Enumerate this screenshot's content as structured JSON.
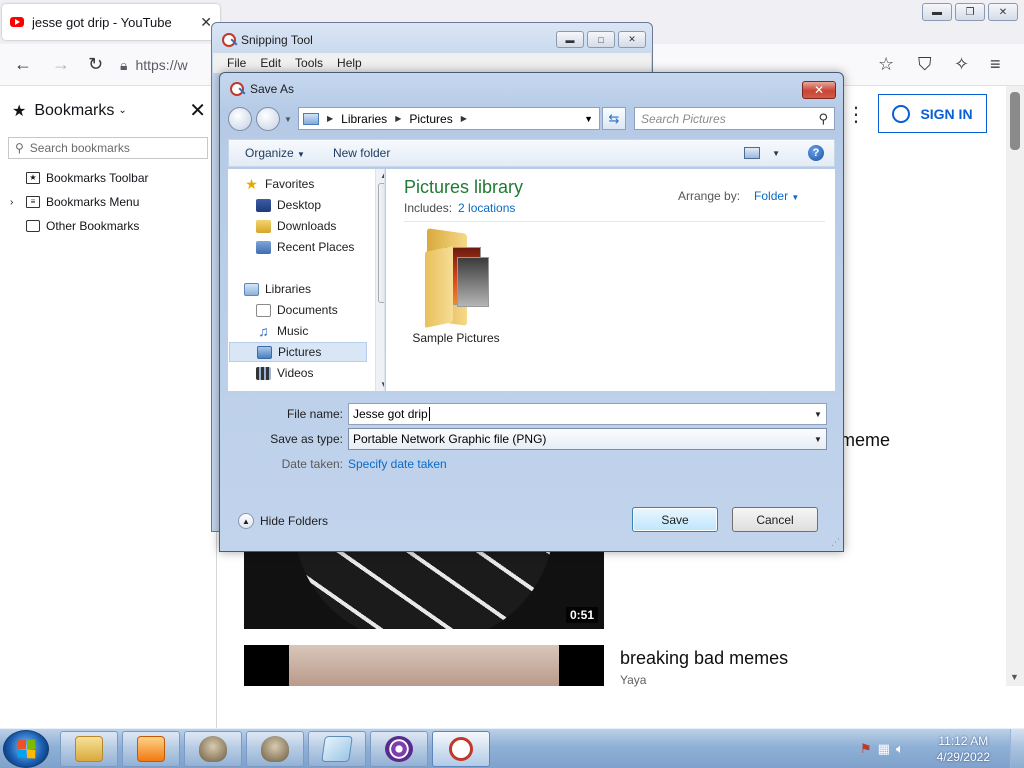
{
  "firefox": {
    "tab_title": "jesse got drip - YouTube",
    "tab_close": "✕",
    "url_text": "https://w",
    "sidebar": {
      "title": "Bookmarks",
      "search_placeholder": "Search bookmarks",
      "items": [
        {
          "label": "Bookmarks Toolbar"
        },
        {
          "label": "Bookmarks Menu"
        },
        {
          "label": "Other Bookmarks"
        }
      ]
    },
    "signin_label": "SIGN IN",
    "videos": [
      {
        "title_fragment": "meme",
        "duration": "0:51"
      },
      {
        "title": "breaking bad memes",
        "channel": "Yaya"
      }
    ]
  },
  "snipping_tool": {
    "title": "Snipping Tool",
    "menu": [
      "File",
      "Edit",
      "Tools",
      "Help"
    ]
  },
  "save_dialog": {
    "title": "Save As",
    "close_label": "✕",
    "breadcrumb": [
      "Libraries",
      "Pictures"
    ],
    "search_placeholder": "Search Pictures",
    "toolbar": {
      "organize": "Organize",
      "new_folder": "New folder"
    },
    "nav_pane": {
      "favorites": {
        "label": "Favorites",
        "items": [
          "Desktop",
          "Downloads",
          "Recent Places"
        ]
      },
      "libraries": {
        "label": "Libraries",
        "items": [
          "Documents",
          "Music",
          "Pictures",
          "Videos"
        ],
        "selected": "Pictures"
      }
    },
    "library_title": "Pictures library",
    "includes_label": "Includes:",
    "includes_link": "2 locations",
    "arrange_label": "Arrange by:",
    "arrange_value": "Folder",
    "folders": [
      {
        "name": "Sample Pictures"
      }
    ],
    "file_name_label": "File name:",
    "file_name_value": "Jesse got drip",
    "save_type_label": "Save as type:",
    "save_type_value": "Portable Network Graphic file (PNG)",
    "date_taken_label": "Date taken:",
    "date_taken_link": "Specify date taken",
    "hide_folders": "Hide Folders",
    "save_button": "Save",
    "cancel_button": "Cancel"
  },
  "taskbar": {
    "clock_time": "11:12 AM",
    "clock_date": "4/29/2022",
    "buttons": [
      "explorer-icon",
      "media-player-icon",
      "skull-app-icon",
      "skull-app-icon",
      "notepad-icon",
      "tor-browser-icon",
      "snipping-tool-icon"
    ]
  },
  "colors": {
    "accent_blue": "#065fd4",
    "link_blue": "#0a6bc7",
    "library_green": "#1e7b34",
    "youtube_red": "#ff0000"
  }
}
